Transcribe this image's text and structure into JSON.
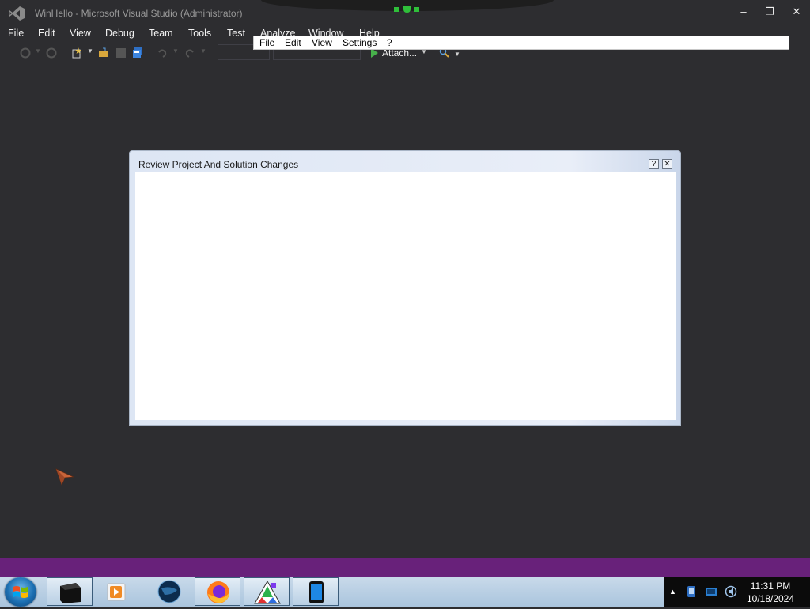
{
  "window": {
    "title": "WinHello - Microsoft Visual Studio (Administrator)",
    "controls": {
      "minimize": "–",
      "restore": "❐",
      "close": "✕"
    }
  },
  "menu": [
    "File",
    "Edit",
    "View",
    "Debug",
    "Team",
    "Tools",
    "Test",
    "Analyze",
    "Window",
    "Help"
  ],
  "overlay_menu": [
    "File",
    "Edit",
    "View",
    "Settings",
    "?"
  ],
  "toolbar": {
    "attach_label": "Attach...",
    "icons": [
      "back-icon",
      "forward-icon",
      "new-project-icon",
      "open-file-icon",
      "save-icon",
      "save-all-icon",
      "undo-icon",
      "redo-icon",
      "start-icon",
      "find-icon"
    ]
  },
  "dialog": {
    "title": "Review Project And Solution Changes",
    "help_glyph": "?",
    "close_glyph": "✕"
  },
  "taskbar": {
    "apps": [
      "terminal-app",
      "media-player-app",
      "globe-app",
      "firefox-app",
      "paint-app",
      "device-app"
    ],
    "tray_icons": [
      "network-icon",
      "display-icon",
      "volume-icon"
    ],
    "show_hidden_glyph": "▲",
    "time": "11:31 PM",
    "date": "10/18/2024"
  },
  "colors": {
    "vs_background": "#2d2d30",
    "vs_accent_purple": "#68217a",
    "dialog_gradient_start": "#dde6f4",
    "taskbar_blue": "#a9c4dd"
  }
}
